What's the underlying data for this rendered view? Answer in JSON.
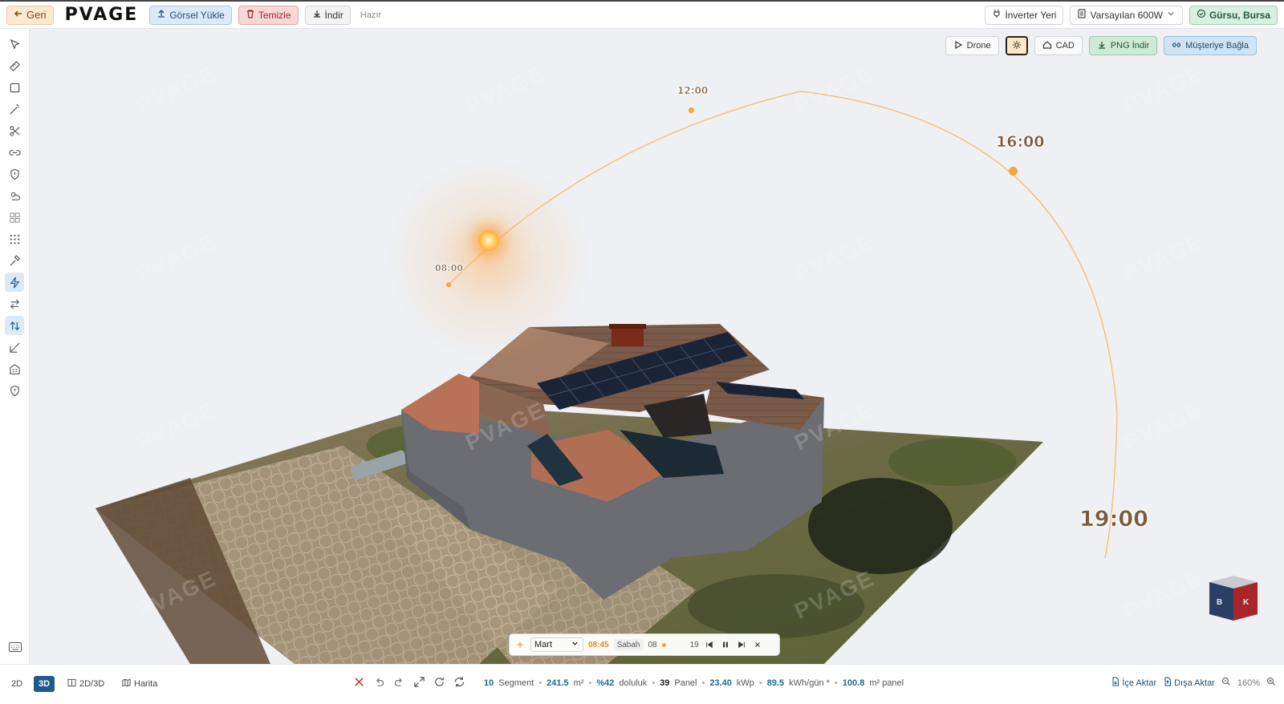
{
  "topbar": {
    "back_label": "Geri",
    "logo": "PVAGE",
    "upload_label": "Görsel Yükle",
    "clear_label": "Temizle",
    "download_label": "İndir",
    "status": "Hazır",
    "inverter_label": "İnverter Yeri",
    "panel_select": "Varsayılan 600W",
    "location": "Gürsu, Bursa"
  },
  "view_controls": {
    "drone": "Drone",
    "cad": "CAD",
    "png": "PNG İndir",
    "customer": "Müşteriye Bağla"
  },
  "sunpath": {
    "labels": [
      "08:00",
      "12:00",
      "16:00",
      "19:00"
    ]
  },
  "watermark": "PVAGE",
  "navcube": {
    "left": "B",
    "right": "K"
  },
  "timebar": {
    "month": "Mart",
    "clock": "08:45",
    "period": "Sabah",
    "start_hour": "08",
    "end_hour": "19"
  },
  "bottombar": {
    "mode_2d": "2D",
    "mode_3d": "3D",
    "mode_2d3d": "2D/3D",
    "mode_map": "Harita",
    "stats": {
      "segments": "10",
      "segments_unit": "Segment",
      "area": "241.5",
      "area_unit": "m²",
      "fill": "%42",
      "fill_unit": "doluluk",
      "panels": "39",
      "panels_unit": "Panel",
      "kwp": "23.40",
      "kwp_unit": "kWp",
      "daily": "89.5",
      "daily_unit": "kWh/gün *",
      "panel_area": "100.8",
      "panel_area_unit": "m² panel"
    },
    "import_label": "İçe Aktar",
    "export_label": "Dışa Aktar",
    "zoom": "160%"
  },
  "colors": {
    "accent": "#1e5a8c",
    "sun": "#f5a53a",
    "building": "#6b6d72"
  }
}
